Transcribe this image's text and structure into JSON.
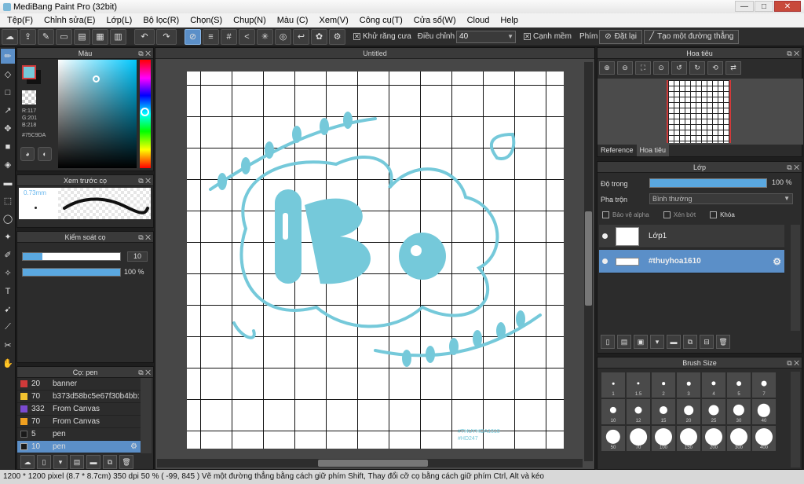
{
  "window": {
    "title": "MediBang Paint Pro (32bit)",
    "min": "—",
    "max": "□",
    "close": "✕"
  },
  "menu": [
    "Tệp(F)",
    "Chỉnh sửa(E)",
    "Lớp(L)",
    "Bộ lọc(R)",
    "Chọn(S)",
    "Chụp(N)",
    "Màu (C)",
    "Xem(V)",
    "Công cụ(T)",
    "Cửa sổ(W)",
    "Cloud",
    "Help"
  ],
  "toolbar": {
    "antialias_label": "Khử răng cưa",
    "correction_label": "Điều chỉnh",
    "correction_value": "40",
    "sharp_label": "Cạnh mềm",
    "key_label": "Phím",
    "reset_label": "Đặt lại",
    "straight_line_label": "Tạo một đường thẳng"
  },
  "color_panel": {
    "title": "Màu",
    "r": "R:117",
    "g": "G:201",
    "b": "B:218",
    "hex": "#75C9DA",
    "color": "#75C9DA"
  },
  "brush_preview": {
    "title": "Xem trước cọ",
    "size": "0.73mm"
  },
  "brush_control": {
    "title": "Kiểm soát cọ",
    "size_value": "10",
    "size_fraction": 0.2,
    "opacity_value": "100 %",
    "opacity_fraction": 1.0
  },
  "brush_list": {
    "title": "Cọ: pen",
    "items": [
      {
        "num": "20",
        "name": "banner",
        "color": "#d03a3a"
      },
      {
        "num": "70",
        "name": "b373d58bc5e67f30b4bb:",
        "color": "#f2c230"
      },
      {
        "num": "332",
        "name": "From Canvas",
        "color": "#7a4ad0"
      },
      {
        "num": "70",
        "name": "From Canvas",
        "color": "#f0a020"
      },
      {
        "num": "5",
        "name": "pen",
        "color": "#1a1a1a"
      },
      {
        "num": "10",
        "name": "pen",
        "color": "#1a1a1a"
      }
    ]
  },
  "canvas": {
    "tab_title": "Untitled",
    "watermark_1": "#THUYHOA1610",
    "watermark_2": "#HD247"
  },
  "navigator": {
    "title": "Hoa tiêu",
    "tab_reference": "Reference",
    "tab_navigator": "Hoa tiêu"
  },
  "layers": {
    "title": "Lớp",
    "opacity_label": "Độ trong",
    "opacity_value": "100 %",
    "opacity_fraction": 1.0,
    "blend_label": "Pha trộn",
    "blend_value": "Bình thường",
    "protect_alpha": "Bảo vệ alpha",
    "clipping": "Xén bớt",
    "lock": "Khóa",
    "items": [
      {
        "name": "Lớp1",
        "selected": false
      },
      {
        "name": "#thuyhoa1610",
        "selected": true
      }
    ]
  },
  "brush_size": {
    "title": "Brush Size",
    "sizes": [
      "1",
      "1.5",
      "2",
      "3",
      "4",
      "5",
      "7",
      "10",
      "12",
      "15",
      "20",
      "25",
      "30",
      "40",
      "50",
      "70",
      "100",
      "150",
      "200",
      "300",
      "400"
    ]
  },
  "status": {
    "text": "1200 * 1200 pixel  (8.7 * 8.7cm)  350 dpi  50 %  ( -99, 845 )  Vẽ một đường thẳng bằng cách giữ phím Shift, Thay đổi cỡ cọ bằng cách giữ phím Ctrl, Alt và kéo"
  }
}
